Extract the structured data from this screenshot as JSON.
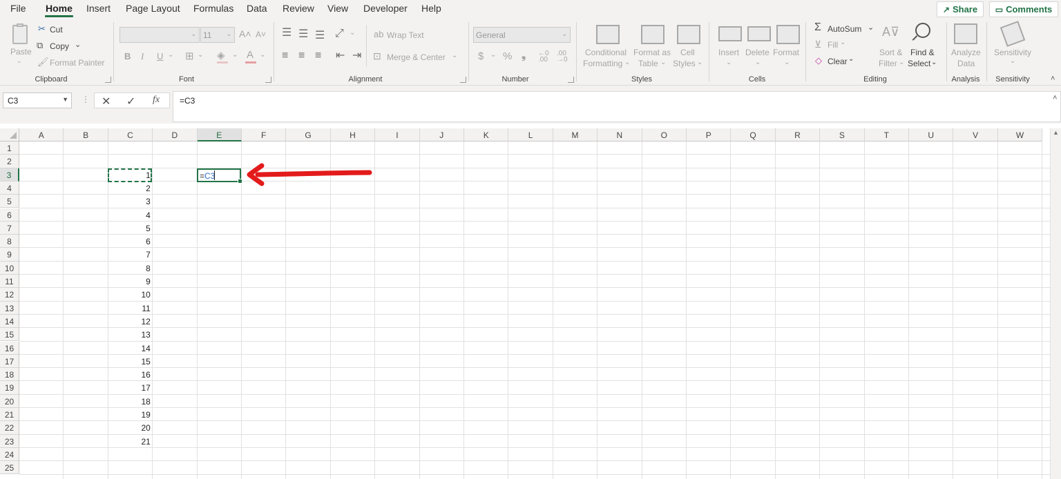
{
  "tabs": [
    "File",
    "Home",
    "Insert",
    "Page Layout",
    "Formulas",
    "Data",
    "Review",
    "View",
    "Developer",
    "Help"
  ],
  "share_label": "Share",
  "comments_label": "Comments",
  "clipboard": {
    "paste": "Paste",
    "cut": "Cut",
    "copy": "Copy",
    "format_painter": "Format Painter",
    "label": "Clipboard"
  },
  "font": {
    "size": "11",
    "label": "Font"
  },
  "alignment": {
    "wrap_text": "Wrap Text",
    "merge_center": "Merge & Center",
    "label": "Alignment"
  },
  "number": {
    "format": "General",
    "label": "Number"
  },
  "styles": {
    "conditional_1": "Conditional",
    "conditional_2": "Formatting",
    "format_as_1": "Format as",
    "format_as_2": "Table",
    "cell_1": "Cell",
    "cell_2": "Styles",
    "label": "Styles"
  },
  "cells": {
    "insert": "Insert",
    "delete": "Delete",
    "format": "Format",
    "label": "Cells"
  },
  "editing": {
    "autosum": "AutoSum",
    "fill": "Fill",
    "clear": "Clear",
    "sort_1": "Sort &",
    "sort_2": "Filter",
    "find_1": "Find &",
    "find_2": "Select",
    "label": "Editing"
  },
  "analysis": {
    "analyze_1": "Analyze",
    "analyze_2": "Data",
    "label": "Analysis"
  },
  "sensitivity": {
    "button": "Sensitivity",
    "label": "Sensitivity"
  },
  "name_box": "C3",
  "formula": "=C3",
  "columns": [
    "A",
    "B",
    "C",
    "D",
    "E",
    "F",
    "G",
    "H",
    "I",
    "J",
    "K",
    "L",
    "M",
    "N",
    "O",
    "P",
    "Q",
    "R",
    "S",
    "T",
    "U",
    "V",
    "W"
  ],
  "rows": [
    "1",
    "2",
    "3",
    "4",
    "5",
    "6",
    "7",
    "8",
    "9",
    "10",
    "11",
    "12",
    "13",
    "14",
    "15",
    "16",
    "17",
    "18",
    "19",
    "20",
    "21",
    "22",
    "23",
    "24",
    "25"
  ],
  "cell_values_c": [
    "1",
    "2",
    "3",
    "4",
    "5",
    "6",
    "7",
    "8",
    "9",
    "10",
    "11",
    "12",
    "13",
    "14",
    "15",
    "16",
    "17",
    "18",
    "19",
    "20",
    "21"
  ],
  "edit_cell": {
    "prefix": "=",
    "ref": "C3"
  },
  "colors": {
    "accent": "#217346",
    "arrow": "#e31b1b",
    "ref": "#2f6fcf"
  }
}
